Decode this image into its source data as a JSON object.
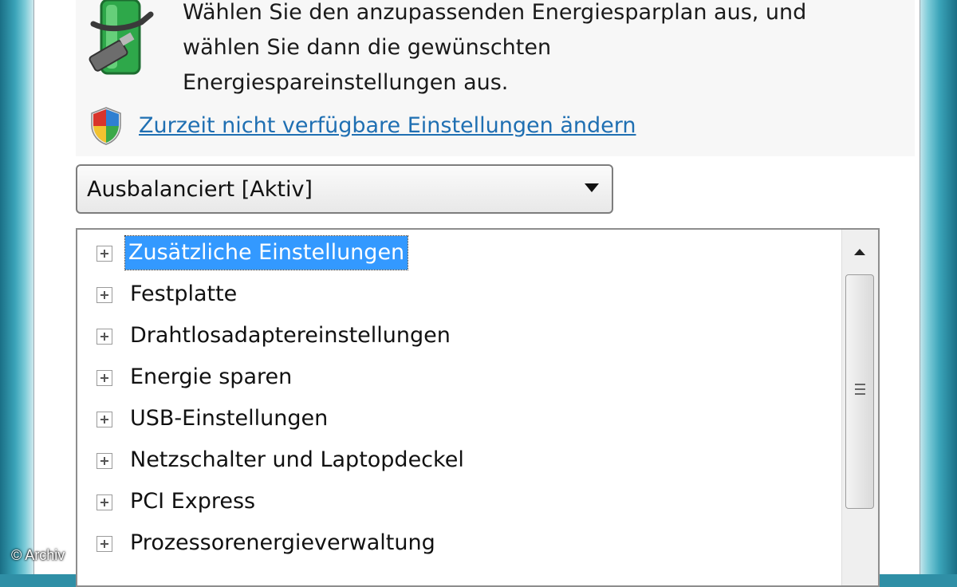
{
  "header": {
    "instruction_lines": [
      "Wählen Sie den anzupassenden Energiesparplan aus, und",
      "wählen Sie dann die gewünschten",
      "Energiespareinstellungen aus."
    ],
    "battery_icon": "battery-plug-icon",
    "shield_icon": "uac-shield-icon",
    "settings_link": "Zurzeit nicht verfügbare Einstellungen ändern"
  },
  "plan_select": {
    "value": "Ausbalanciert [Aktiv]",
    "icon": "chevron-down-icon"
  },
  "tree": {
    "items": [
      {
        "label": "Zusätzliche Einstellungen",
        "selected": true
      },
      {
        "label": "Festplatte"
      },
      {
        "label": "Drahtlosadaptereinstellungen"
      },
      {
        "label": "Energie sparen"
      },
      {
        "label": "USB-Einstellungen"
      },
      {
        "label": "Netzschalter und Laptopdeckel"
      },
      {
        "label": "PCI Express"
      },
      {
        "label": "Prozessorenergieverwaltung"
      }
    ]
  },
  "watermark": "© Archiv",
  "colors": {
    "link": "#1f6fb2",
    "selection": "#3399ff",
    "frame": "#2f8fa6"
  }
}
